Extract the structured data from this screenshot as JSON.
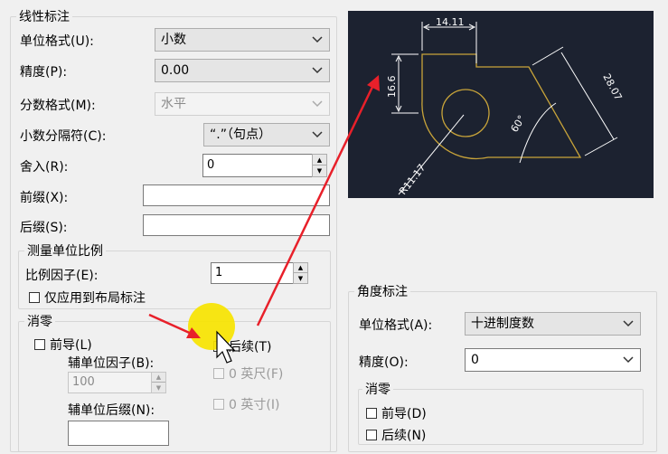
{
  "linear": {
    "title": "线性标注",
    "unit_format_label": "单位格式(U):",
    "unit_format_value": "小数",
    "precision_label": "精度(P):",
    "precision_value": "0.00",
    "fraction_format_label": "分数格式(M):",
    "fraction_format_value": "水平",
    "decimal_sep_label": "小数分隔符(C):",
    "decimal_sep_value": "“.”（句点）",
    "round_label": "舍入(R):",
    "round_value": "0",
    "prefix_label": "前缀(X):",
    "prefix_value": "",
    "suffix_label": "后缀(S):",
    "suffix_value": ""
  },
  "scale": {
    "title": "测量单位比例",
    "factor_label": "比例因子(E):",
    "factor_value": "1",
    "layout_only_label": "仅应用到布局标注"
  },
  "zero_suppress": {
    "title": "消零",
    "leading_label": "前导(L)",
    "trailing_label": "后续(T)",
    "sub_factor_label": "辅单位因子(B):",
    "sub_factor_value": "100",
    "feet_label": "0 英尺(F)",
    "sub_suffix_label": "辅单位后缀(N):",
    "sub_suffix_value": "",
    "inches_label": "0 英寸(I)"
  },
  "angular": {
    "title": "角度标注",
    "unit_format_label": "单位格式(A):",
    "unit_format_value": "十进制度数",
    "precision_label": "精度(O):",
    "precision_value": "0",
    "zero_title": "消零",
    "leading_label": "前导(D)",
    "trailing_label": "后续(N)"
  },
  "preview": {
    "dim_top": "14.11",
    "dim_left": "16.6",
    "dim_right": "28.07",
    "dim_angle": "60°",
    "dim_radius": "R11.17"
  },
  "colors": {
    "preview_bg": "#1c2230",
    "geometry": "#c8a43a",
    "dim_lines": "#ffffff",
    "annotation_arrow": "#e8202a",
    "cursor_highlight": "#f7e400"
  }
}
